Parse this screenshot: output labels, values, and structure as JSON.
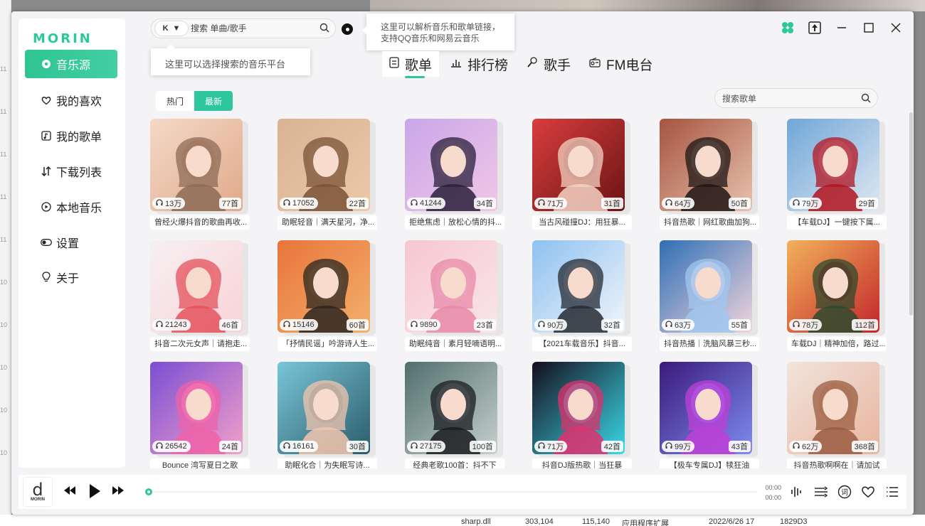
{
  "app": {
    "logo": "MORIN"
  },
  "search": {
    "source_label": "K",
    "placeholder": "搜索 单曲/歌手"
  },
  "tooltips": {
    "source": "这里可以选择搜索的音乐平台",
    "link_line1": "这里可以解析音乐和歌单链接，",
    "link_line2": "支持QQ音乐和网易云音乐"
  },
  "sidebar": {
    "items": [
      {
        "label": "音乐源",
        "icon": "music-source-icon",
        "active": true
      },
      {
        "label": "我的喜欢",
        "icon": "heart-icon"
      },
      {
        "label": "我的歌单",
        "icon": "playlist-icon"
      },
      {
        "label": "下载列表",
        "icon": "download-icon"
      },
      {
        "label": "本地音乐",
        "icon": "local-music-icon"
      },
      {
        "label": "设置",
        "icon": "settings-toggle-icon"
      },
      {
        "label": "关于",
        "icon": "bulb-icon"
      }
    ]
  },
  "tabs": [
    {
      "label": "歌单",
      "icon": "songlist-icon",
      "active": true
    },
    {
      "label": "排行榜",
      "icon": "chart-icon"
    },
    {
      "label": "歌手",
      "icon": "singer-icon"
    },
    {
      "label": "FM电台",
      "icon": "radio-icon"
    }
  ],
  "filter": {
    "hot": "热门",
    "latest": "最新",
    "selected": "最新"
  },
  "playlist_search": {
    "placeholder": "搜索歌单"
  },
  "playlists": [
    {
      "plays": "13万",
      "count": "77首",
      "title": "曾经火爆抖音的歌曲再收..."
    },
    {
      "plays": "17052",
      "count": "22首",
      "title": "助眠轻音｜满天星河，净..."
    },
    {
      "plays": "41244",
      "count": "34首",
      "title": "拒绝焦虑｜放松心情的抖..."
    },
    {
      "plays": "71万",
      "count": "31首",
      "title": "当古风碰撞DJ：用狂暴..."
    },
    {
      "plays": "64万",
      "count": "50首",
      "title": "抖音热歌｜网红歌曲加狗..."
    },
    {
      "plays": "79万",
      "count": "29首",
      "title": "【车载DJ】一键按下属..."
    },
    {
      "plays": "21243",
      "count": "46首",
      "title": "抖音二次元女声｜请抱走..."
    },
    {
      "plays": "15146",
      "count": "60首",
      "title": "「抒情民谣」吟游诗人生..."
    },
    {
      "plays": "9890",
      "count": "23首",
      "title": "助眠纯音｜素月轻喃语明..."
    },
    {
      "plays": "90万",
      "count": "32首",
      "title": "【2021车载音乐】抖音..."
    },
    {
      "plays": "63万",
      "count": "55首",
      "title": "抖音热播｜洗脑风暴三秒..."
    },
    {
      "plays": "78万",
      "count": "112首",
      "title": "车载DJ｜精神加倍，路过..."
    },
    {
      "plays": "26542",
      "count": "24首",
      "title": "Bounce 湾写夏日之歌"
    },
    {
      "plays": "16161",
      "count": "30首",
      "title": "助眠化合｜为失眠写诗..."
    },
    {
      "plays": "27175",
      "count": "100首",
      "title": "经典老歌100首：抖不下"
    },
    {
      "plays": "71万",
      "count": "42首",
      "title": "抖音DJ版热歌｜当狂暴"
    },
    {
      "plays": "99万",
      "count": "43首",
      "title": "【极车专属DJ】犊狂油"
    },
    {
      "plays": "62万",
      "count": "368首",
      "title": "抖音热歌啊啊在｜请加试"
    }
  ],
  "player": {
    "logo_letter": "d",
    "logo_text": "MORIN",
    "current_time": "00:00",
    "total_time": "00:00",
    "progress": 0
  },
  "colors": {
    "accent": "#2ec79b"
  },
  "desktop": {
    "left_labels": [
      "11",
      "11",
      "11",
      "11",
      "11",
      "10",
      "10",
      "10",
      "10",
      "10"
    ],
    "bottom": {
      "name": "sharp.dll",
      "date": "2022/6/26 17",
      "size": "1829D3",
      "size2": "303,104",
      "size3": "115,140",
      "type": "应用程序扩展"
    }
  }
}
